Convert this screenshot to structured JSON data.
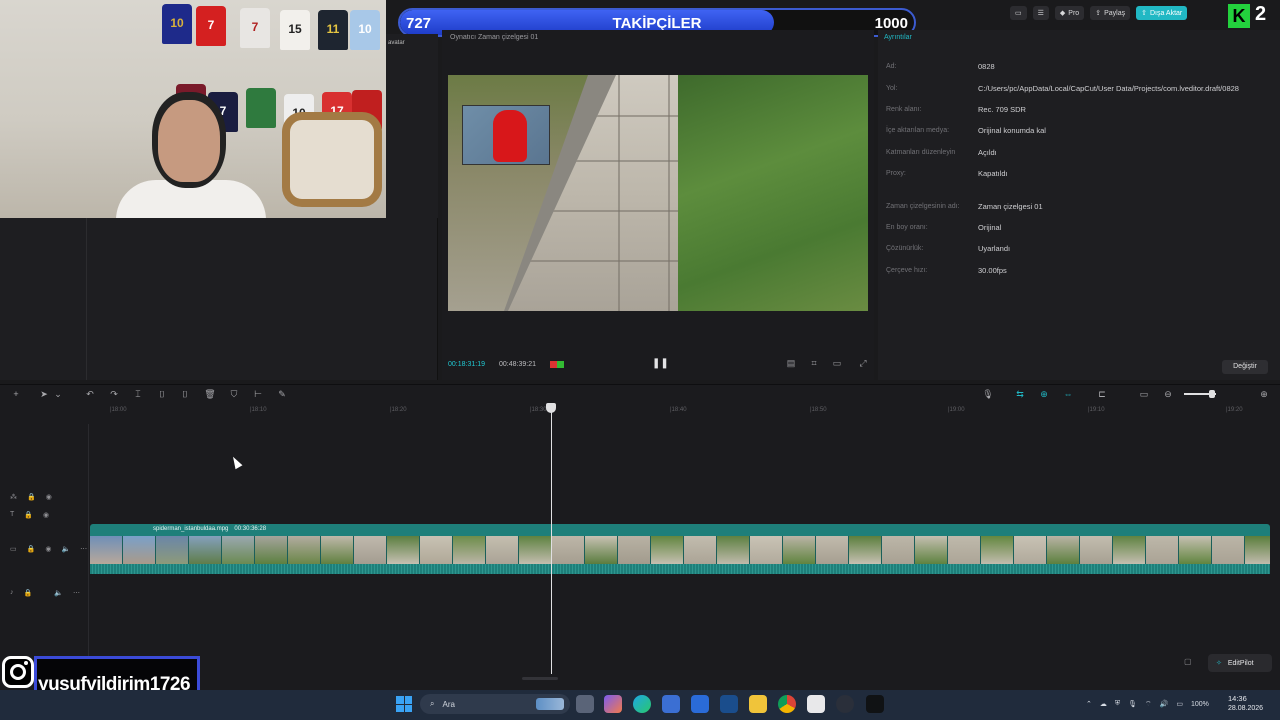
{
  "overlay": {
    "follower_current": "727",
    "follower_title": "TAKİPÇİLER",
    "follower_goal": "1000",
    "follower_progress": 0.727,
    "instagram_handle": "yusufyildirim1726",
    "k_count": "2"
  },
  "topbar": {
    "pro_label": "Pro",
    "share_label": "Paylaş",
    "export_label": "Dışa Aktar",
    "accent_color": "#21b8c4"
  },
  "left_panel": {
    "avatar_label": "avatar"
  },
  "player": {
    "title": "Oynatıcı Zaman çizelgesi 01",
    "time_current": "00:18:31:19",
    "time_total": "00:48:39:21"
  },
  "properties": {
    "tab_label": "Ayrıntılar",
    "fields": [
      {
        "label": "Ad:",
        "value": "0828"
      },
      {
        "label": "Yol:",
        "value": "C:/Users/pc/AppData/Local/CapCut/User Data/Projects/com.lveditor.draft/0828"
      },
      {
        "label": "Renk alanı:",
        "value": "Rec. 709 SDR"
      },
      {
        "label": "İçe aktarılan medya:",
        "value": "Orijinal konumda kal"
      },
      {
        "label": "Katmanları düzenleyin",
        "value": "Açıldı"
      },
      {
        "label": "Proxy:",
        "value": "Kapatıldı"
      },
      {
        "label": "Zaman çizelgesinin adı:",
        "value": "Zaman çizelgesi 01"
      },
      {
        "label": "En boy oranı:",
        "value": "Orijinal"
      },
      {
        "label": "Çözünürlük:",
        "value": "Uyarlandı"
      },
      {
        "label": "Çerçeve hızı:",
        "value": "30.00fps"
      }
    ],
    "change_button": "Değiştir"
  },
  "timeline": {
    "ticks": [
      "|18:00",
      "|18:10",
      "|18:20",
      "|18:30",
      "|18:40",
      "|18:50",
      "|19:00",
      "|19:10",
      "|19:20"
    ],
    "clip_name": "spiderman_istanbuldaa.mpg",
    "clip_duration": "00:30:36:28",
    "clip_color": "#1e7f7a",
    "editpilot_label": "EditPilot"
  },
  "taskbar": {
    "search_placeholder": "Ara",
    "battery": "100%",
    "time": "14:36",
    "date": "28.08.2026"
  }
}
